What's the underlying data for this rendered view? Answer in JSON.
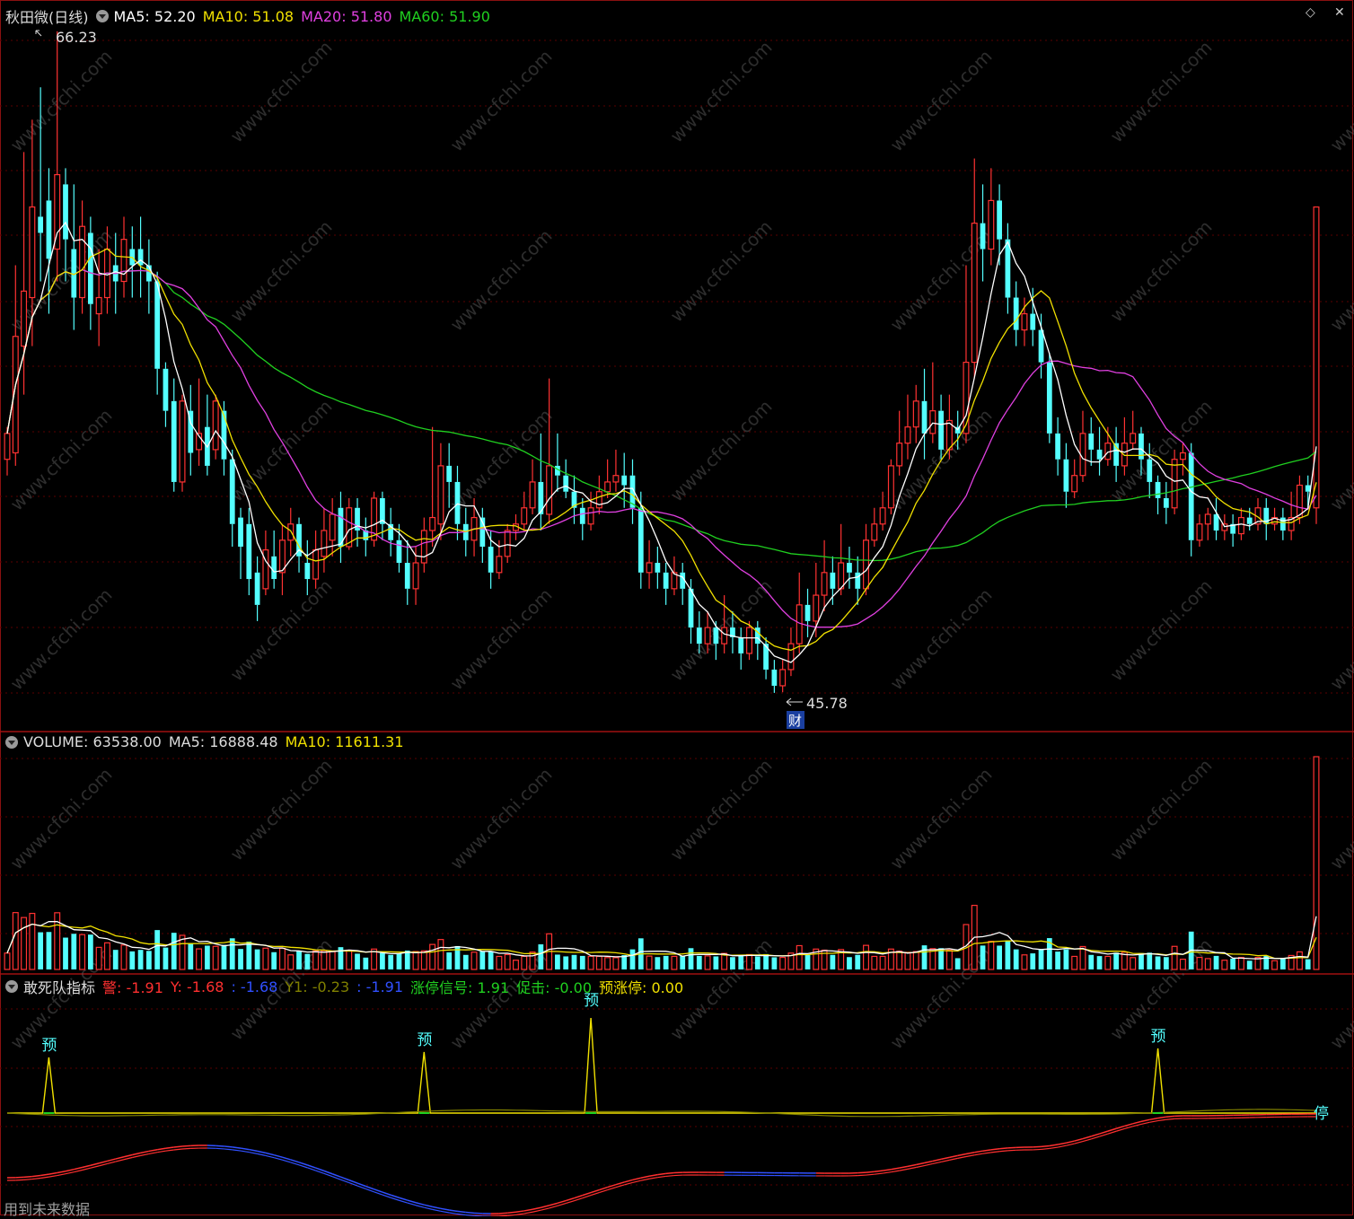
{
  "header": {
    "stock_title": "秋田微(日线)",
    "ma5": "MA5: 52.20",
    "ma10": "MA10: 51.08",
    "ma20": "MA20: 51.80",
    "ma60": "MA60: 51.90"
  },
  "price": {
    "high_label": "66.23",
    "low_label": "45.78",
    "finance_badge": "财"
  },
  "volume": {
    "label": "VOLUME: 63538.00",
    "ma5": "MA5: 16888.48",
    "ma10": "MA10: 11611.31"
  },
  "indicator": {
    "title": "敢死队指标",
    "alert": "警: -1.91",
    "y": "Y: -1.68",
    "blank1": ": -1.68",
    "y1": "Y1: -0.23",
    "blank2": ": -1.91",
    "limit_up_signal": "涨停信号: 1.91",
    "boost": "促击: -0.00",
    "pre_limit_up": "预涨停: 0.00",
    "pre_marker": "预",
    "stop_marker": "停"
  },
  "watermark": "www.cfchi.com",
  "footer": "用到未来数据",
  "colors": {
    "up": "#ff3232",
    "down": "#54ffff",
    "ma5": "#ffffff",
    "ma10": "#f0e000",
    "ma20": "#e040e0",
    "ma60": "#20d020",
    "grid": "#5a0000"
  },
  "chart_data": [
    {
      "type": "candlestick",
      "title": "秋田微(日线)",
      "ylim": [
        45.0,
        66.7
      ],
      "high": 66.23,
      "low": 45.78,
      "moving_averages": {
        "MA5": 52.2,
        "MA10": 51.08,
        "MA20": 51.8,
        "MA60": 51.9
      },
      "candles": [
        [
          53.0,
          53.8,
          52.5,
          54.0
        ],
        [
          53.2,
          56.8,
          52.8,
          59.0
        ],
        [
          56.5,
          58.2,
          55.0,
          62.5
        ],
        [
          58.0,
          60.8,
          56.5,
          63.5
        ],
        [
          60.5,
          60.0,
          58.5,
          64.5
        ],
        [
          61.0,
          59.2,
          57.5,
          62.0
        ],
        [
          59.5,
          61.8,
          58.5,
          66.23
        ],
        [
          61.5,
          59.8,
          58.5,
          62.0
        ],
        [
          59.5,
          58.0,
          57.0,
          61.5
        ],
        [
          58.0,
          60.2,
          57.5,
          61.0
        ],
        [
          60.0,
          57.8,
          57.0,
          60.5
        ],
        [
          57.5,
          58.0,
          56.5,
          59.5
        ],
        [
          58.0,
          59.5,
          57.5,
          60.2
        ],
        [
          59.0,
          58.5,
          57.5,
          60.0
        ],
        [
          58.5,
          59.8,
          58.0,
          60.5
        ],
        [
          59.5,
          59.0,
          58.0,
          60.2
        ],
        [
          59.5,
          59.0,
          58.0,
          60.5
        ],
        [
          59.0,
          58.5,
          57.5,
          59.8
        ],
        [
          58.5,
          55.8,
          55.0,
          58.8
        ],
        [
          55.8,
          54.5,
          54.0,
          56.0
        ],
        [
          54.8,
          52.3,
          52.0,
          55.5
        ],
        [
          52.3,
          54.8,
          52.0,
          55.0
        ],
        [
          54.5,
          53.2,
          52.5,
          55.3
        ],
        [
          53.3,
          53.8,
          52.8,
          55.5
        ],
        [
          54.0,
          52.8,
          52.5,
          55.0
        ],
        [
          53.3,
          54.8,
          53.0,
          55.0
        ],
        [
          54.5,
          53.0,
          52.5,
          54.8
        ],
        [
          53.0,
          51.0,
          50.3,
          53.3
        ],
        [
          51.2,
          50.3,
          49.3,
          51.5
        ],
        [
          51.0,
          49.3,
          48.8,
          51.5
        ],
        [
          49.5,
          48.5,
          48.0,
          50.0
        ],
        [
          49.0,
          50.2,
          48.8,
          50.8
        ],
        [
          50.0,
          49.3,
          49.0,
          50.8
        ],
        [
          49.5,
          50.5,
          48.8,
          51.0
        ],
        [
          50.5,
          51.0,
          50.0,
          51.5
        ],
        [
          51.0,
          50.0,
          49.5,
          51.2
        ],
        [
          49.8,
          49.3,
          48.8,
          50.5
        ],
        [
          49.3,
          50.2,
          49.0,
          50.8
        ],
        [
          50.0,
          50.8,
          49.5,
          51.5
        ],
        [
          50.5,
          51.3,
          50.0,
          51.8
        ],
        [
          51.5,
          50.3,
          49.8,
          52.0
        ],
        [
          50.3,
          51.5,
          50.2,
          51.8
        ],
        [
          51.5,
          50.8,
          50.3,
          51.8
        ],
        [
          50.8,
          50.5,
          50.0,
          51.2
        ],
        [
          50.5,
          51.8,
          50.3,
          52.0
        ],
        [
          51.8,
          51.0,
          50.5,
          52.0
        ],
        [
          51.0,
          50.5,
          50.0,
          51.5
        ],
        [
          50.5,
          49.8,
          49.5,
          51.0
        ],
        [
          49.8,
          49.0,
          48.5,
          50.5
        ],
        [
          49.0,
          49.8,
          48.5,
          50.3
        ],
        [
          49.8,
          50.8,
          49.5,
          51.2
        ],
        [
          50.8,
          51.2,
          50.3,
          54.0
        ],
        [
          51.0,
          52.8,
          50.5,
          53.5
        ],
        [
          52.8,
          52.3,
          51.5,
          53.5
        ],
        [
          52.3,
          51.0,
          50.5,
          52.8
        ],
        [
          51.0,
          50.5,
          50.0,
          51.5
        ],
        [
          50.5,
          51.2,
          50.0,
          51.8
        ],
        [
          51.2,
          50.3,
          49.8,
          51.5
        ],
        [
          50.3,
          49.5,
          49.0,
          50.8
        ],
        [
          49.5,
          50.0,
          49.3,
          50.5
        ],
        [
          50.0,
          50.8,
          49.8,
          51.0
        ],
        [
          50.8,
          51.0,
          50.5,
          51.3
        ],
        [
          51.0,
          51.5,
          50.8,
          52.0
        ],
        [
          51.5,
          52.3,
          51.3,
          53.0
        ],
        [
          52.3,
          51.3,
          50.8,
          53.8
        ],
        [
          51.3,
          52.8,
          51.0,
          55.5
        ],
        [
          52.8,
          52.5,
          52.0,
          53.8
        ],
        [
          52.5,
          52.0,
          51.8,
          53.0
        ],
        [
          52.0,
          51.5,
          51.0,
          52.5
        ],
        [
          51.5,
          51.0,
          50.5,
          51.8
        ],
        [
          51.0,
          51.5,
          50.8,
          52.0
        ],
        [
          51.5,
          52.0,
          51.3,
          52.5
        ],
        [
          52.0,
          52.3,
          51.8,
          53.0
        ],
        [
          52.3,
          52.5,
          52.0,
          53.3
        ],
        [
          52.5,
          52.2,
          51.5,
          53.2
        ],
        [
          52.5,
          51.5,
          51.0,
          53.0
        ],
        [
          51.5,
          49.5,
          49.0,
          52.0
        ],
        [
          49.5,
          49.8,
          49.0,
          50.5
        ],
        [
          49.8,
          49.5,
          49.0,
          50.3
        ],
        [
          49.5,
          49.0,
          48.5,
          49.8
        ],
        [
          49.0,
          49.5,
          48.8,
          50.0
        ],
        [
          49.5,
          49.0,
          48.5,
          49.8
        ],
        [
          49.0,
          47.8,
          47.3,
          49.3
        ],
        [
          47.8,
          47.3,
          47.0,
          48.3
        ],
        [
          47.3,
          47.8,
          47.0,
          48.3
        ],
        [
          47.8,
          47.3,
          46.8,
          48.0
        ],
        [
          47.3,
          47.8,
          47.0,
          48.8
        ],
        [
          47.8,
          47.5,
          47.0,
          48.3
        ],
        [
          47.5,
          47.0,
          46.5,
          47.8
        ],
        [
          47.0,
          47.8,
          46.8,
          48.0
        ],
        [
          47.8,
          47.3,
          46.8,
          48.0
        ],
        [
          47.3,
          46.5,
          46.2,
          47.5
        ],
        [
          46.5,
          46.0,
          45.78,
          46.8
        ],
        [
          46.0,
          46.5,
          45.8,
          46.8
        ],
        [
          46.5,
          47.3,
          46.3,
          47.8
        ],
        [
          47.3,
          48.5,
          47.0,
          49.5
        ],
        [
          48.5,
          48.0,
          47.5,
          49.0
        ],
        [
          48.0,
          48.8,
          47.5,
          49.8
        ],
        [
          48.8,
          49.5,
          48.3,
          50.5
        ],
        [
          49.5,
          49.0,
          48.5,
          50.0
        ],
        [
          49.0,
          49.8,
          48.8,
          51.0
        ],
        [
          49.8,
          49.5,
          49.0,
          50.3
        ],
        [
          49.5,
          49.0,
          48.5,
          50.0
        ],
        [
          49.0,
          50.5,
          48.8,
          51.0
        ],
        [
          50.5,
          51.0,
          50.3,
          51.5
        ],
        [
          51.0,
          51.5,
          50.8,
          52.0
        ],
        [
          51.5,
          52.8,
          51.3,
          53.0
        ],
        [
          52.8,
          53.5,
          52.5,
          54.5
        ],
        [
          53.5,
          54.0,
          53.0,
          55.0
        ],
        [
          54.0,
          54.8,
          53.5,
          55.3
        ],
        [
          54.8,
          53.8,
          53.0,
          55.8
        ],
        [
          53.8,
          54.5,
          53.5,
          56.0
        ],
        [
          54.5,
          53.3,
          53.0,
          55.0
        ],
        [
          53.3,
          54.2,
          53.0,
          55.0
        ],
        [
          54.0,
          53.8,
          53.3,
          54.5
        ],
        [
          53.8,
          56.0,
          53.5,
          59.0
        ],
        [
          56.0,
          60.3,
          55.5,
          62.3
        ],
        [
          60.3,
          59.5,
          58.5,
          61.5
        ],
        [
          59.5,
          61.0,
          59.0,
          62.0
        ],
        [
          61.0,
          59.8,
          59.0,
          61.5
        ],
        [
          59.8,
          58.0,
          57.5,
          60.3
        ],
        [
          58.0,
          57.0,
          56.5,
          58.5
        ],
        [
          57.0,
          57.5,
          56.5,
          58.0
        ],
        [
          57.5,
          57.0,
          56.5,
          58.3
        ],
        [
          57.0,
          56.0,
          55.5,
          57.5
        ],
        [
          56.0,
          53.8,
          53.5,
          56.3
        ],
        [
          53.8,
          53.0,
          52.5,
          54.3
        ],
        [
          53.0,
          52.0,
          51.5,
          53.5
        ],
        [
          52.0,
          52.5,
          51.8,
          53.0
        ],
        [
          52.5,
          53.8,
          52.3,
          54.5
        ],
        [
          53.8,
          53.3,
          52.8,
          54.3
        ],
        [
          53.3,
          53.0,
          52.5,
          54.0
        ],
        [
          53.0,
          53.5,
          52.8,
          54.0
        ],
        [
          53.5,
          52.8,
          52.3,
          54.0
        ],
        [
          52.8,
          53.5,
          52.5,
          54.3
        ],
        [
          53.5,
          53.8,
          53.3,
          54.5
        ],
        [
          53.8,
          53.0,
          52.5,
          54.0
        ],
        [
          53.0,
          52.3,
          51.8,
          53.5
        ],
        [
          52.3,
          51.8,
          51.3,
          52.5
        ],
        [
          51.8,
          51.5,
          51.0,
          52.3
        ],
        [
          51.5,
          53.0,
          51.3,
          53.3
        ],
        [
          53.0,
          53.2,
          52.5,
          53.5
        ],
        [
          53.2,
          50.5,
          50.0,
          53.5
        ],
        [
          50.5,
          51.0,
          50.3,
          51.3
        ],
        [
          51.0,
          51.3,
          50.5,
          51.5
        ],
        [
          51.3,
          50.8,
          50.5,
          51.8
        ],
        [
          50.8,
          51.0,
          50.5,
          51.3
        ],
        [
          51.0,
          50.7,
          50.3,
          51.3
        ],
        [
          50.7,
          51.2,
          50.5,
          51.5
        ],
        [
          51.2,
          51.0,
          50.8,
          51.5
        ],
        [
          51.0,
          51.5,
          50.8,
          51.8
        ],
        [
          51.5,
          51.0,
          50.5,
          51.8
        ],
        [
          51.0,
          51.2,
          50.8,
          51.5
        ],
        [
          51.2,
          50.8,
          50.5,
          51.5
        ],
        [
          50.8,
          51.2,
          50.5,
          52.0
        ],
        [
          51.2,
          52.2,
          51.0,
          52.5
        ],
        [
          52.2,
          52.0,
          51.5,
          52.5
        ],
        [
          51.5,
          60.8,
          51.0,
          60.8
        ]
      ]
    },
    {
      "type": "bar",
      "title": "VOLUME",
      "latest": 63538.0,
      "ma5": 16888.48,
      "ma10": 11611.31
    },
    {
      "type": "line",
      "title": "敢死队指标",
      "series_values": {
        "警": -1.91,
        "Y": -1.68,
        "Y1": -0.23,
        "涨停信号": 1.91,
        "促击": -0.0,
        "预涨停": 0.0
      }
    }
  ]
}
